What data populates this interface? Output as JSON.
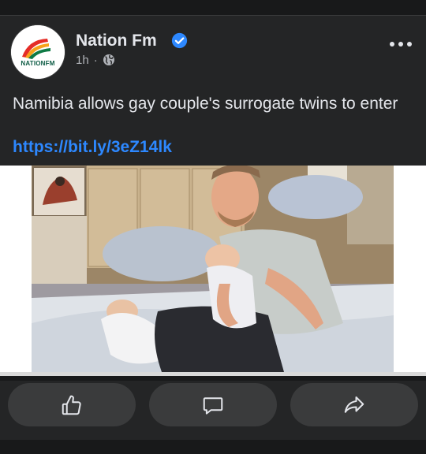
{
  "post": {
    "page_name": "Nation Fm",
    "avatar_text": "NATIONFM",
    "time": "1h",
    "separator": "·",
    "text": "Namibia allows gay couple's surrogate twins to enter",
    "link": "https://bit.ly/3eZ14lk"
  },
  "icons": {
    "verified": "verified-badge-icon",
    "audience": "globe-icon",
    "more": "more-options-icon",
    "like": "thumbs-up-icon",
    "comment": "comment-bubble-icon",
    "share": "share-arrow-icon"
  },
  "colors": {
    "background": "#18191a",
    "card": "#242526",
    "button": "#3a3b3c",
    "link": "#2d88ff",
    "verified": "#2d88ff",
    "text_primary": "#e4e6eb",
    "text_secondary": "#b0b3b8"
  }
}
